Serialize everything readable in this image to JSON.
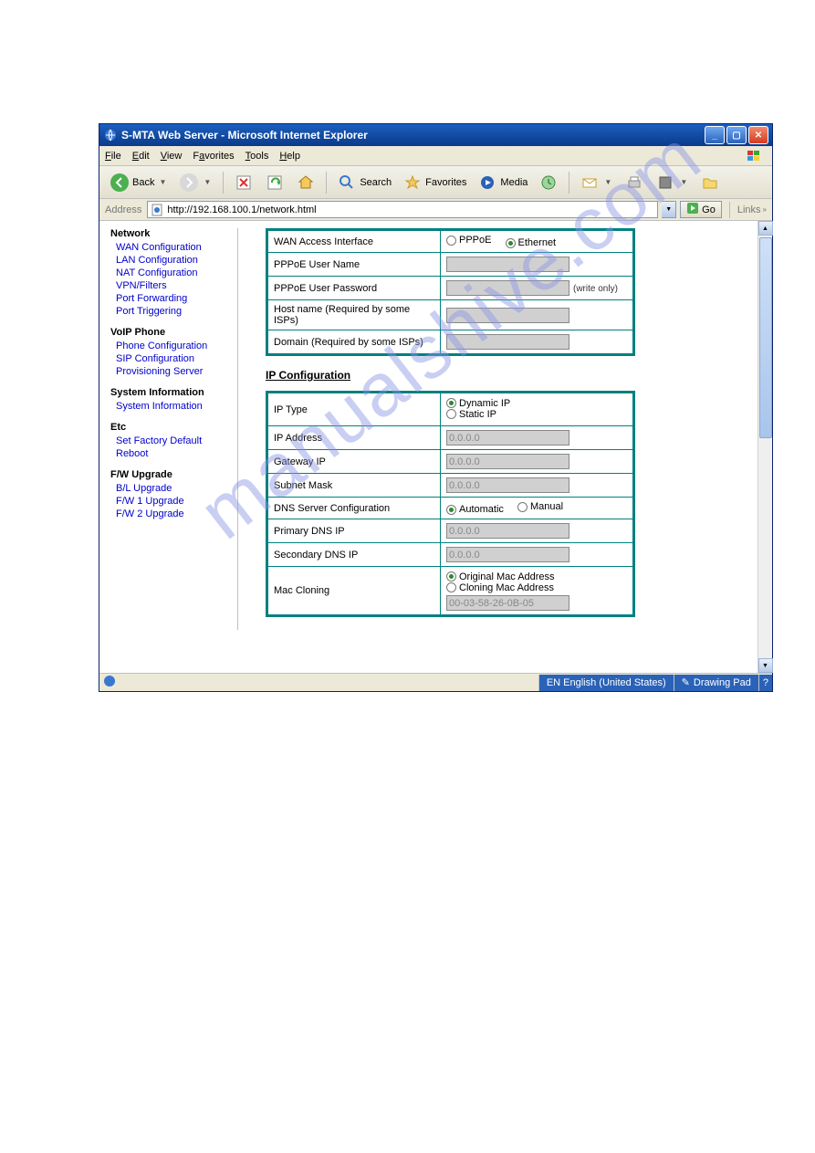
{
  "window": {
    "title": "S-MTA Web Server - Microsoft Internet Explorer"
  },
  "menu": {
    "file": "File",
    "edit": "Edit",
    "view": "View",
    "favorites": "Favorites",
    "tools": "Tools",
    "help": "Help"
  },
  "toolbar": {
    "back": "Back",
    "search": "Search",
    "favorites": "Favorites",
    "media": "Media"
  },
  "address": {
    "label": "Address",
    "url": "http://192.168.100.1/network.html",
    "go": "Go",
    "links": "Links"
  },
  "sidebar": {
    "network": {
      "title": "Network",
      "items": [
        "WAN Configuration",
        "LAN Configuration",
        "NAT Configuration",
        "VPN/Filters",
        "Port Forwarding",
        "Port Triggering"
      ]
    },
    "voip": {
      "title": "VoIP Phone",
      "items": [
        "Phone Configuration",
        "SIP Configuration",
        "Provisioning Server"
      ]
    },
    "sysinfo": {
      "title": "System Information",
      "items": [
        "System Information"
      ]
    },
    "etc": {
      "title": "Etc",
      "items": [
        "Set Factory Default",
        "Reboot"
      ]
    },
    "fw": {
      "title": "F/W Upgrade",
      "items": [
        "B/L Upgrade",
        "F/W 1 Upgrade",
        "F/W 2 Upgrade"
      ]
    }
  },
  "wan": {
    "access_label": "WAN Access Interface",
    "pppoe_opt": "PPPoE",
    "ethernet_opt": "Ethernet",
    "user_label": "PPPoE User Name",
    "pass_label": "PPPoE User Password",
    "write_only": "(write only)",
    "host_label": "Host name (Required by some ISPs)",
    "domain_label": "Domain (Required by some ISPs)"
  },
  "ipcfg": {
    "heading": "IP Configuration",
    "iptype_label": "IP Type",
    "dynamic": "Dynamic IP",
    "static": "Static IP",
    "ipaddr_label": "IP Address",
    "ipaddr_val": "0.0.0.0",
    "gateway_label": "Gateway IP",
    "gateway_val": "0.0.0.0",
    "subnet_label": "Subnet Mask",
    "subnet_val": "0.0.0.0",
    "dns_cfg_label": "DNS Server Configuration",
    "auto": "Automatic",
    "manual": "Manual",
    "pdns_label": "Primary DNS IP",
    "pdns_val": "0.0.0.0",
    "sdns_label": "Secondary DNS IP",
    "sdns_val": "0.0.0.0",
    "mac_label": "Mac Cloning",
    "orig_mac": "Original Mac Address",
    "clone_mac": "Cloning Mac Address",
    "mac_val": "00-03-58-26-0B-05"
  },
  "status": {
    "lang": "EN English (United States)",
    "pad": "Drawing Pad"
  },
  "watermark": "manualshive.com"
}
